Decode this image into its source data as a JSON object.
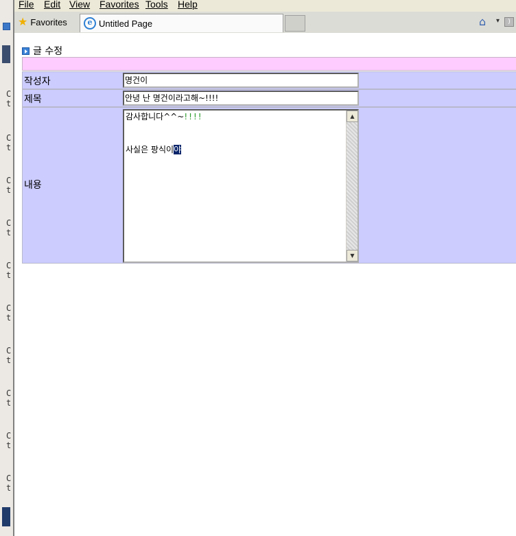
{
  "menu": {
    "file": "File",
    "edit": "Edit",
    "view": "View",
    "favorites": "Favorites",
    "tools": "Tools",
    "help": "Help"
  },
  "toolbar": {
    "favorites_label": "Favorites",
    "tab_title": "Untitled Page",
    "icons": [
      "star-icon",
      "ie-page-icon",
      "home-icon",
      "dropdown-icon",
      "rss-icon"
    ]
  },
  "page": {
    "heading": "글 수정",
    "rows": {
      "author_label": "작성자",
      "author_value": "명건이",
      "title_label": "제목",
      "title_value": "안녕 난 명건이라고해~!!!!",
      "content_label": "내용",
      "content_line1": "감사합니다^^~",
      "content_line1_tail": "!!!!",
      "content_line3": "사실은 팡식이",
      "content_selected": "야"
    }
  },
  "colors": {
    "form_row_bg": "#ccccff",
    "header_row_bg": "#ffccff",
    "selection_bg": "#0a246a",
    "menubar_bg": "#ece9d8"
  }
}
